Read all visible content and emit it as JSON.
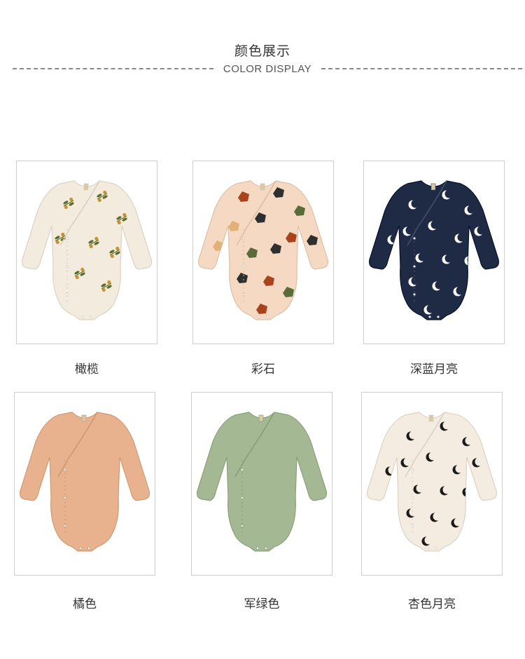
{
  "header": {
    "title": "颜色展示",
    "subtitle": "COLOR DISPLAY"
  },
  "products": [
    {
      "label": "橄榄",
      "body_color": "#f3ebdd",
      "pattern": "olive-sprigs",
      "pattern_colors": [
        "#5c6a2a",
        "#c8922e"
      ]
    },
    {
      "label": "彩石",
      "body_color": "#f5d9c2",
      "pattern": "terrazzo",
      "pattern_colors": [
        "#2f2f2f",
        "#a9431e",
        "#5a6b3a",
        "#e0b27a"
      ]
    },
    {
      "label": "深蓝月亮",
      "body_color": "#1f2a44",
      "pattern": "crescent-moons",
      "pattern_colors": [
        "#ffffff"
      ]
    },
    {
      "label": "橘色",
      "body_color": "#e9b28e",
      "pattern": "solid",
      "pattern_colors": []
    },
    {
      "label": "军绿色",
      "body_color": "#a3b893",
      "pattern": "solid",
      "pattern_colors": []
    },
    {
      "label": "杏色月亮",
      "body_color": "#f4ece0",
      "pattern": "crescent-moons",
      "pattern_colors": [
        "#1a1a1a"
      ]
    }
  ]
}
